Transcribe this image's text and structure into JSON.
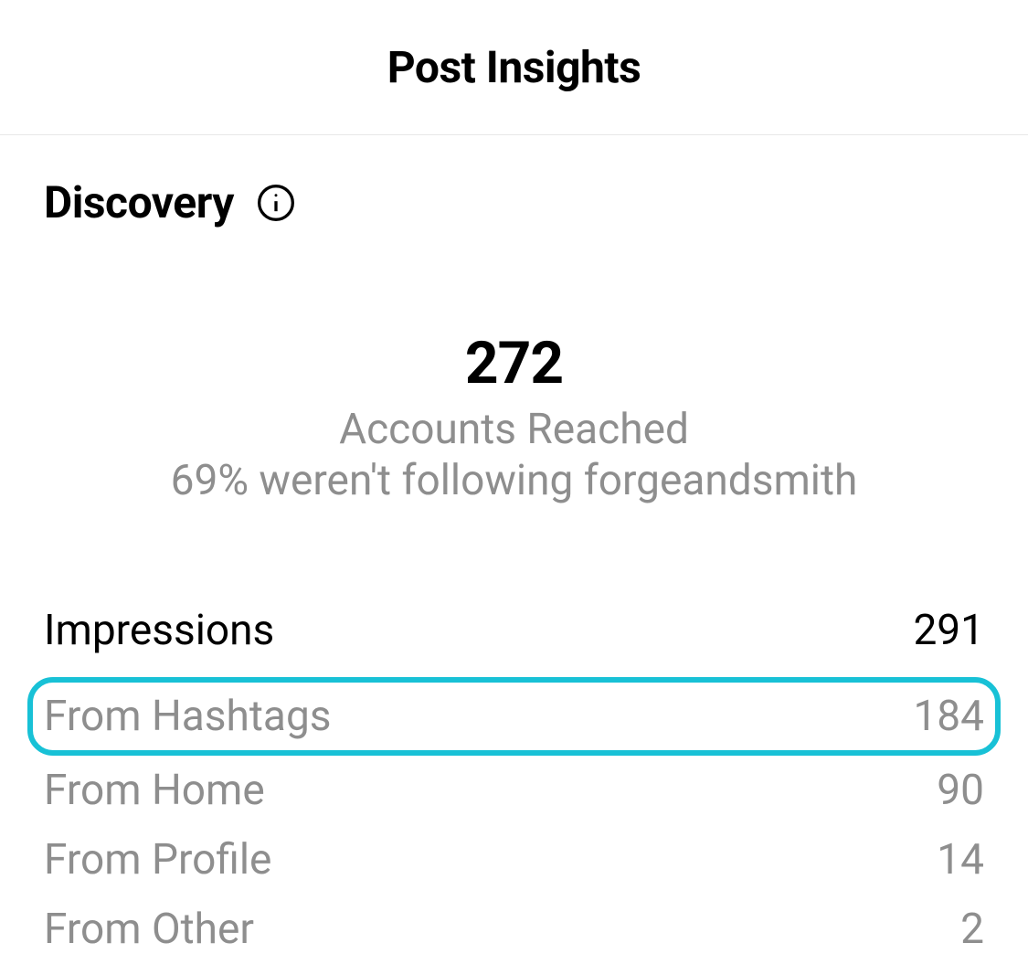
{
  "header": {
    "title": "Post Insights"
  },
  "discovery": {
    "title": "Discovery",
    "accounts_reached_value": "272",
    "accounts_reached_label": "Accounts Reached",
    "accounts_reached_detail": "69% weren't following forgeandsmith"
  },
  "impressions": {
    "label": "Impressions",
    "total": "291",
    "breakdown": [
      {
        "label": "From Hashtags",
        "value": "184",
        "highlighted": true
      },
      {
        "label": "From Home",
        "value": "90",
        "highlighted": false
      },
      {
        "label": "From Profile",
        "value": "14",
        "highlighted": false
      },
      {
        "label": "From Other",
        "value": "2",
        "highlighted": false
      }
    ]
  }
}
